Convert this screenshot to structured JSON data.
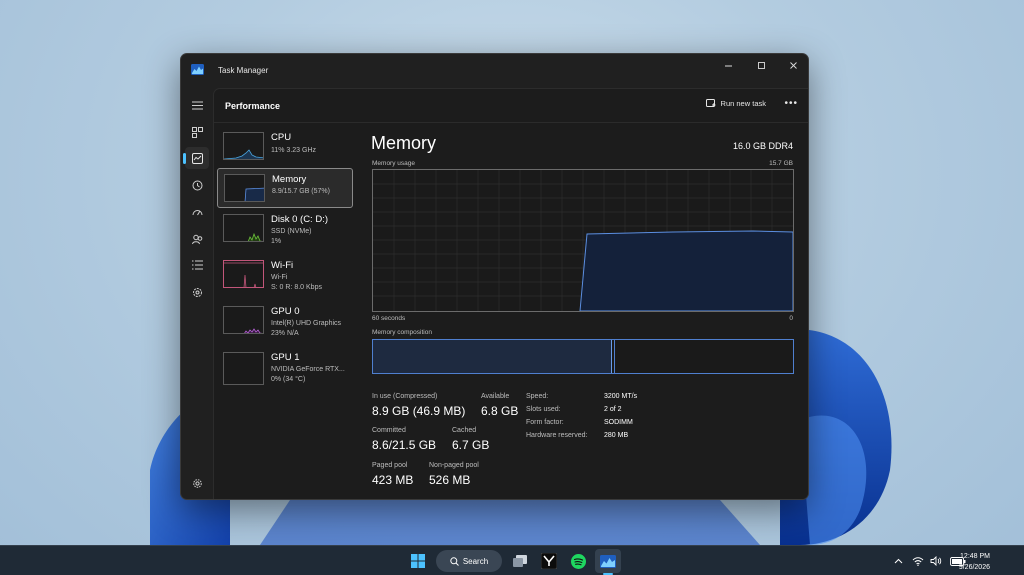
{
  "window": {
    "title": "Task Manager"
  },
  "header": {
    "title": "Performance",
    "run_new_task": "Run new task",
    "more": "•••"
  },
  "resources": [
    {
      "name": "CPU",
      "lines": [
        "11% 3.23 GHz"
      ]
    },
    {
      "name": "Memory",
      "lines": [
        "8.9/15.7 GB (57%)"
      ]
    },
    {
      "name": "Disk 0 (C: D:)",
      "lines": [
        "SSD (NVMe)",
        "1%"
      ]
    },
    {
      "name": "Wi-Fi",
      "lines": [
        "Wi-Fi",
        "S: 0 R: 8.0 Kbps"
      ]
    },
    {
      "name": "GPU 0",
      "lines": [
        "Intel(R) UHD Graphics",
        "23% N/A"
      ]
    },
    {
      "name": "GPU 1",
      "lines": [
        "NVIDIA GeForce RTX...",
        "0% (34 °C)"
      ]
    }
  ],
  "memory": {
    "title": "Memory",
    "spec": "16.0 GB DDR4",
    "usage_label": "Memory usage",
    "max_label": "15.7 GB",
    "time_left": "60 seconds",
    "time_right": "0",
    "composition_label": "Memory composition",
    "usage_fraction": 0.57,
    "stats": {
      "in_use_label": "In use (Compressed)",
      "in_use_value": "8.9 GB (46.9 MB)",
      "available_label": "Available",
      "available_value": "6.8 GB",
      "committed_label": "Committed",
      "committed_value": "8.6/21.5 GB",
      "cached_label": "Cached",
      "cached_value": "6.7 GB",
      "paged_label": "Paged pool",
      "paged_value": "423 MB",
      "nonpaged_label": "Non-paged pool",
      "nonpaged_value": "526 MB"
    },
    "specs": [
      {
        "label": "Speed:",
        "value": "3200 MT/s"
      },
      {
        "label": "Slots used:",
        "value": "2 of 2"
      },
      {
        "label": "Form factor:",
        "value": "SODIMM"
      },
      {
        "label": "Hardware reserved:",
        "value": "280 MB"
      }
    ]
  },
  "taskbar": {
    "search_label": "Search",
    "time": "12:48 PM",
    "date": "9/26/2026"
  },
  "colors": {
    "accent": "#4cc2ff",
    "memory_line": "#5b8ee0",
    "memory_fill": "#14213a"
  }
}
